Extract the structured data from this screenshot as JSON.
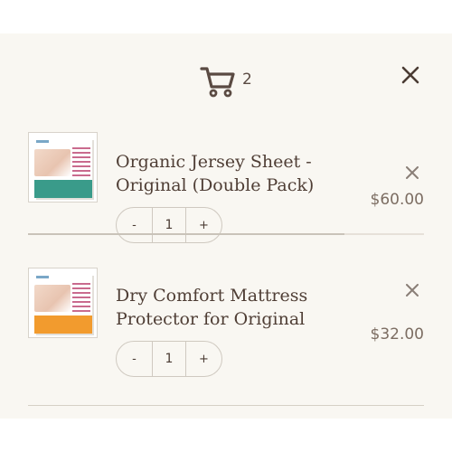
{
  "cart": {
    "count": "2"
  },
  "items": [
    {
      "title": "Organic Jersey Sheet - Original (Double Pack)",
      "quantity": "1",
      "price": "$60.00",
      "decrement_label": "-",
      "increment_label": "+"
    },
    {
      "title": "Dry Comfort Mattress Protector for Original",
      "quantity": "1",
      "price": "$32.00",
      "decrement_label": "-",
      "increment_label": "+"
    }
  ],
  "colors": {
    "background": "#f9f7f2",
    "text": "#4f3e35",
    "price": "#7c6d62",
    "divider": "#c9c3b9"
  },
  "icons": [
    "cart-icon",
    "close-icon",
    "remove-icon"
  ]
}
